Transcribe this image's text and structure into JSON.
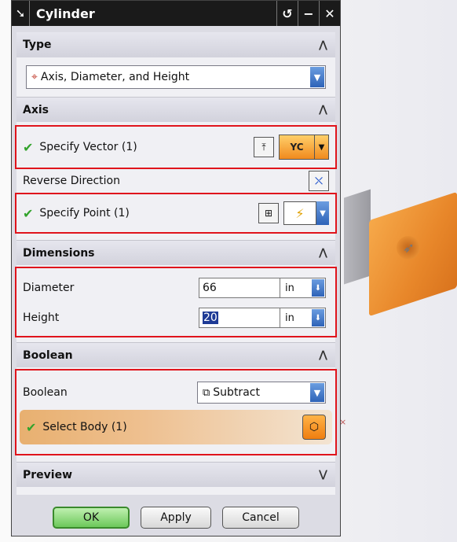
{
  "window": {
    "title": "Cylinder",
    "controls": {
      "reset": "↺",
      "minimize": "−",
      "close": "✕"
    }
  },
  "type_section": {
    "header": "Type",
    "selected": "Axis, Diameter, and Height",
    "icon": "cylinder-type-icon"
  },
  "axis_section": {
    "header": "Axis",
    "specify_vector": "Specify Vector (1)",
    "vector_button": "YC",
    "reverse_direction": "Reverse Direction",
    "specify_point": "Specify Point (1)"
  },
  "dimensions_section": {
    "header": "Dimensions",
    "diameter_label": "Diameter",
    "diameter_value": "66",
    "diameter_unit": "in",
    "height_label": "Height",
    "height_value": "20",
    "height_unit": "in"
  },
  "boolean_section": {
    "header": "Boolean",
    "boolean_label": "Boolean",
    "boolean_value": "Subtract",
    "select_body": "Select Body (1)"
  },
  "preview_section": {
    "header": "Preview"
  },
  "footer": {
    "ok": "OK",
    "apply": "Apply",
    "cancel": "Cancel"
  },
  "colors": {
    "highlight_border": "#e0141c",
    "check": "#33a32c",
    "solid_orange": "#e8872a",
    "dropdown_blue": "#2e63b8"
  }
}
